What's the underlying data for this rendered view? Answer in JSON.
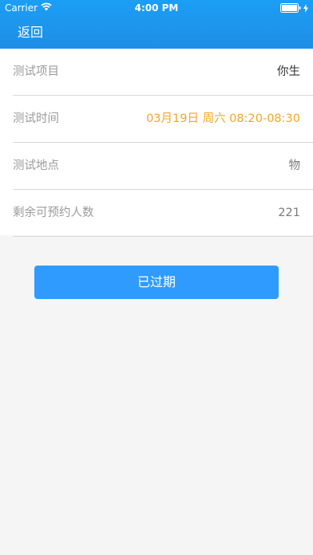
{
  "status_bar": {
    "carrier": "Carrier",
    "time": "4:00 PM",
    "wifi_icon": "wifi-icon",
    "battery_icon": "battery-icon"
  },
  "nav": {
    "back_label": "返回",
    "bg_color": "#1b9ef5"
  },
  "rows": [
    {
      "label": "测试项目",
      "value": "你生"
    },
    {
      "label": "测试时间",
      "value": "03月19日 周六 08:20-08:30"
    },
    {
      "label": "测试地点",
      "value": "物"
    },
    {
      "label": "剩余可预约人数",
      "value": "221"
    }
  ],
  "button": {
    "label": "已过期",
    "color": "#2f9bff"
  },
  "colors": {
    "time_value": "#f5a623",
    "label": "#9a9a9a"
  }
}
